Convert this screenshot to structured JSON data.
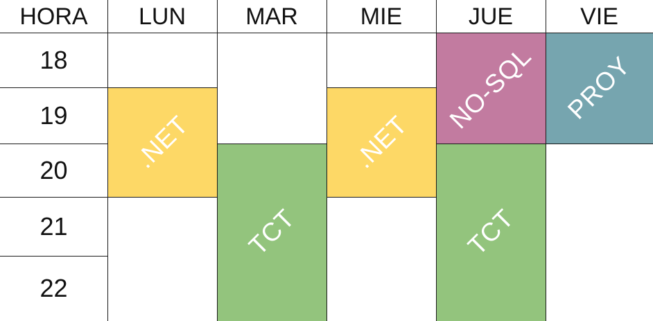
{
  "header": {
    "hora": "HORA",
    "days": [
      "LUN",
      "MAR",
      "MIE",
      "JUE",
      "VIE"
    ]
  },
  "hours": [
    "18",
    "19",
    "20",
    "21",
    "22"
  ],
  "blocks": [
    {
      "id": "lun-net",
      "label": ".NET",
      "color": "#fdd866"
    },
    {
      "id": "mar-tct",
      "label": "TCT",
      "color": "#93c47d"
    },
    {
      "id": "mie-net",
      "label": ".NET",
      "color": "#fdd866"
    },
    {
      "id": "jue-nosql",
      "label": "NO-SQL",
      "color": "#c27ba0"
    },
    {
      "id": "jue-tct",
      "label": "TCT",
      "color": "#93c47d"
    },
    {
      "id": "vie-proy",
      "label": "PROY",
      "color": "#76a5af"
    }
  ]
}
